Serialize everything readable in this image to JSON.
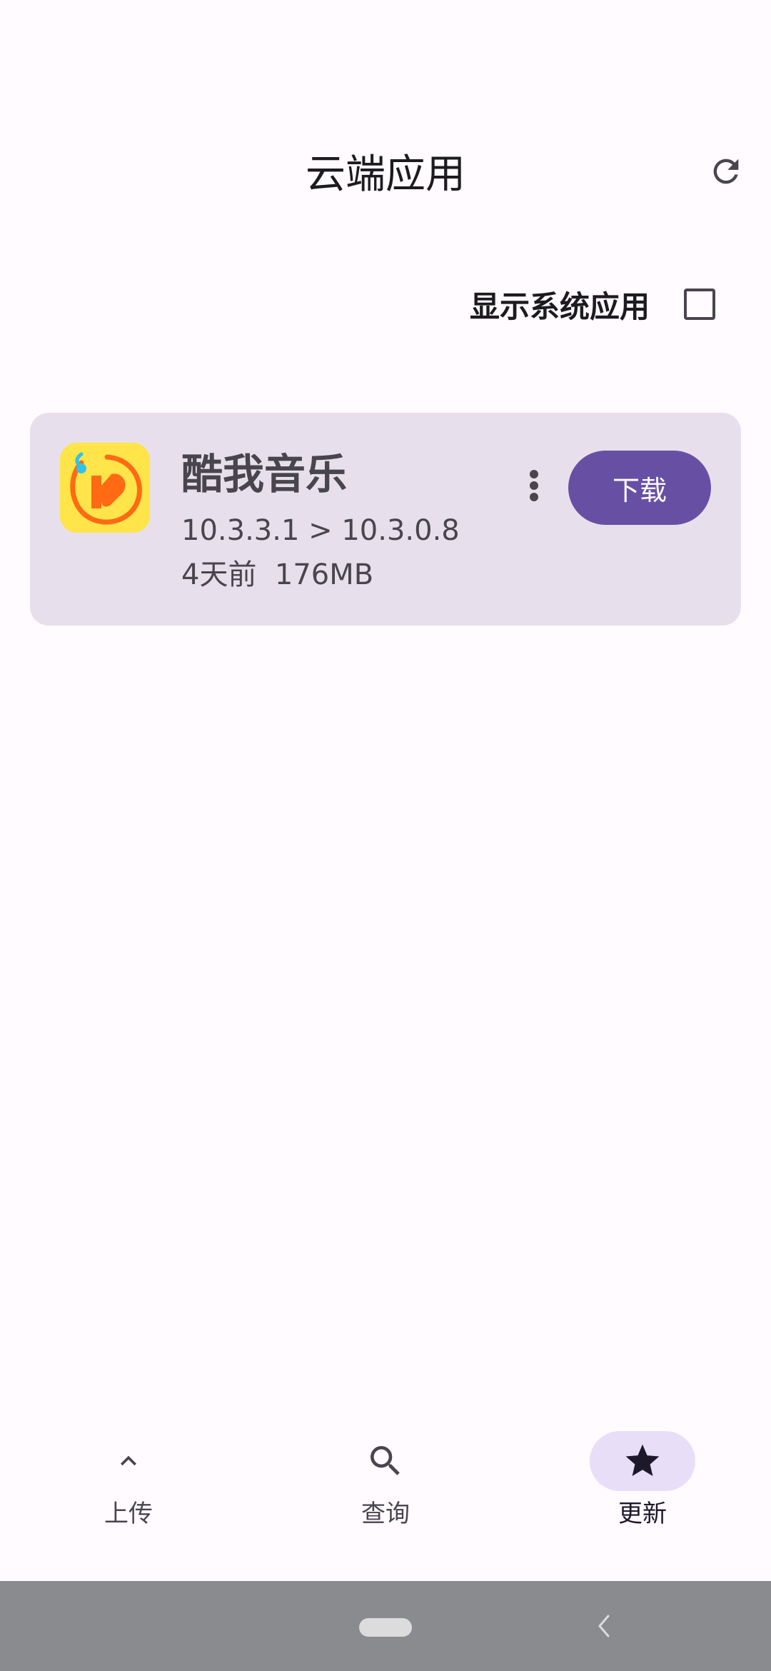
{
  "header": {
    "title": "云端应用",
    "refresh_icon": "refresh-icon"
  },
  "filter": {
    "show_system_apps_label": "显示系统应用",
    "show_system_apps_checked": false
  },
  "apps": [
    {
      "name": "酷我音乐",
      "version": "10.3.3.1 > 10.3.0.8",
      "age": "4天前",
      "size": "176MB",
      "download_label": "下载",
      "icon": "kuwo-music-app-icon"
    }
  ],
  "bottom_nav": {
    "items": [
      {
        "label": "上传",
        "icon": "chevron-up-icon",
        "active": false
      },
      {
        "label": "查询",
        "icon": "search-icon",
        "active": false
      },
      {
        "label": "更新",
        "icon": "star-icon",
        "active": true
      }
    ]
  },
  "colors": {
    "background": "#fffbfe",
    "card": "#e7e0ec",
    "primary": "#6750a4",
    "active_pill": "#e8def8"
  }
}
